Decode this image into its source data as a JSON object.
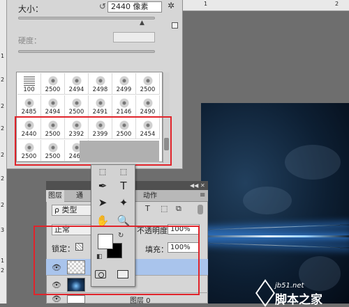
{
  "brush_panel": {
    "size_label": "大小：",
    "size_value": "2440 像素",
    "hardness_label": "硬度：",
    "size_level_fraction": 0.93,
    "presets": [
      {
        "num": "100"
      },
      {
        "num": "2500"
      },
      {
        "num": "2494"
      },
      {
        "num": "2498"
      },
      {
        "num": "2499"
      },
      {
        "num": "2500"
      },
      {
        "num": "2485"
      },
      {
        "num": "2494"
      },
      {
        "num": "2500"
      },
      {
        "num": "2491"
      },
      {
        "num": "2146"
      },
      {
        "num": "2490"
      },
      {
        "num": "2440"
      },
      {
        "num": "2500"
      },
      {
        "num": "2392"
      },
      {
        "num": "2399"
      },
      {
        "num": "2500"
      },
      {
        "num": "2454"
      },
      {
        "num": "2500"
      },
      {
        "num": "2500"
      },
      {
        "num": "2462"
      }
    ]
  },
  "layers_panel": {
    "tabs": [
      "图层",
      "通",
      "动作"
    ],
    "kind_label": "ρ 类型",
    "blend_mode": "正常",
    "opacity_label": "不透明度：",
    "opacity_value": "100%",
    "lock_label": "锁定：",
    "fill_label": "填充：",
    "fill_value": "100%",
    "layers": [
      {
        "name": ""
      },
      {
        "name": ""
      },
      {
        "name": "图层 0"
      }
    ]
  },
  "ruler": {
    "top_numbers": [
      "1",
      "2"
    ],
    "left_numbers": [
      "1",
      "2",
      "2",
      "2",
      "2",
      "2",
      "2",
      "3",
      "1",
      "2"
    ]
  },
  "watermark": {
    "site": "jb51.net",
    "name": "脚本之家"
  },
  "colors": {
    "highlight_box": "#e0242b",
    "foreground": "#ffffff",
    "background": "#000000",
    "beam": "#9fd4ff"
  }
}
